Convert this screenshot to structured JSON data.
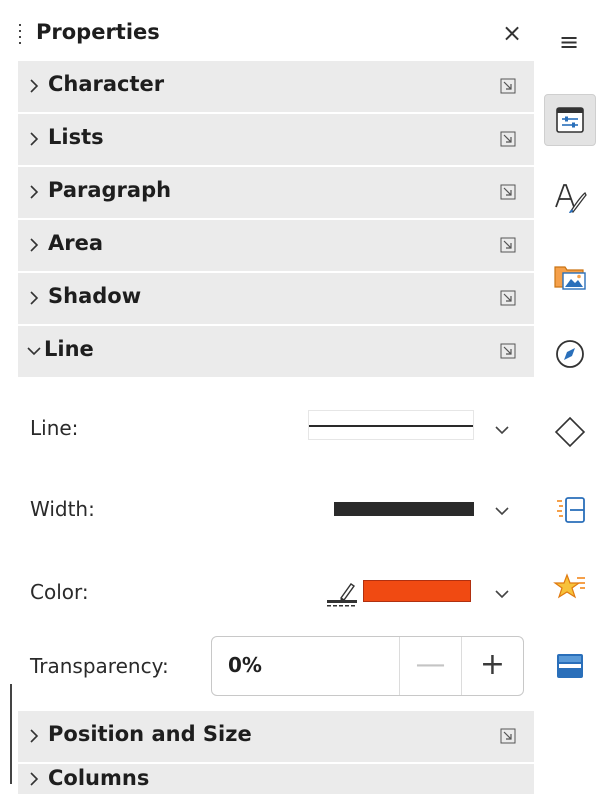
{
  "panel": {
    "title": "Properties",
    "close_symbol": "×"
  },
  "sections": {
    "character": "Character",
    "lists": "Lists",
    "paragraph": "Paragraph",
    "area": "Area",
    "shadow": "Shadow",
    "line": "Line",
    "position_size": "Position and Size",
    "columns": "Columns"
  },
  "line": {
    "line_label": "Line:",
    "width_label": "Width:",
    "color_label": "Color:",
    "color_value": "#f04a12",
    "transparency_label": "Transparency:",
    "transparency_value": "0%",
    "minus_symbol": "—",
    "plus_symbol": "+"
  },
  "sidebar": {
    "menu_symbol": "≡",
    "tabs": [
      "properties-icon",
      "styles-icon",
      "gallery-icon",
      "navigator-icon",
      "shapes-icon",
      "master-slides-icon",
      "animation-icon",
      "slide-transition-icon"
    ]
  }
}
